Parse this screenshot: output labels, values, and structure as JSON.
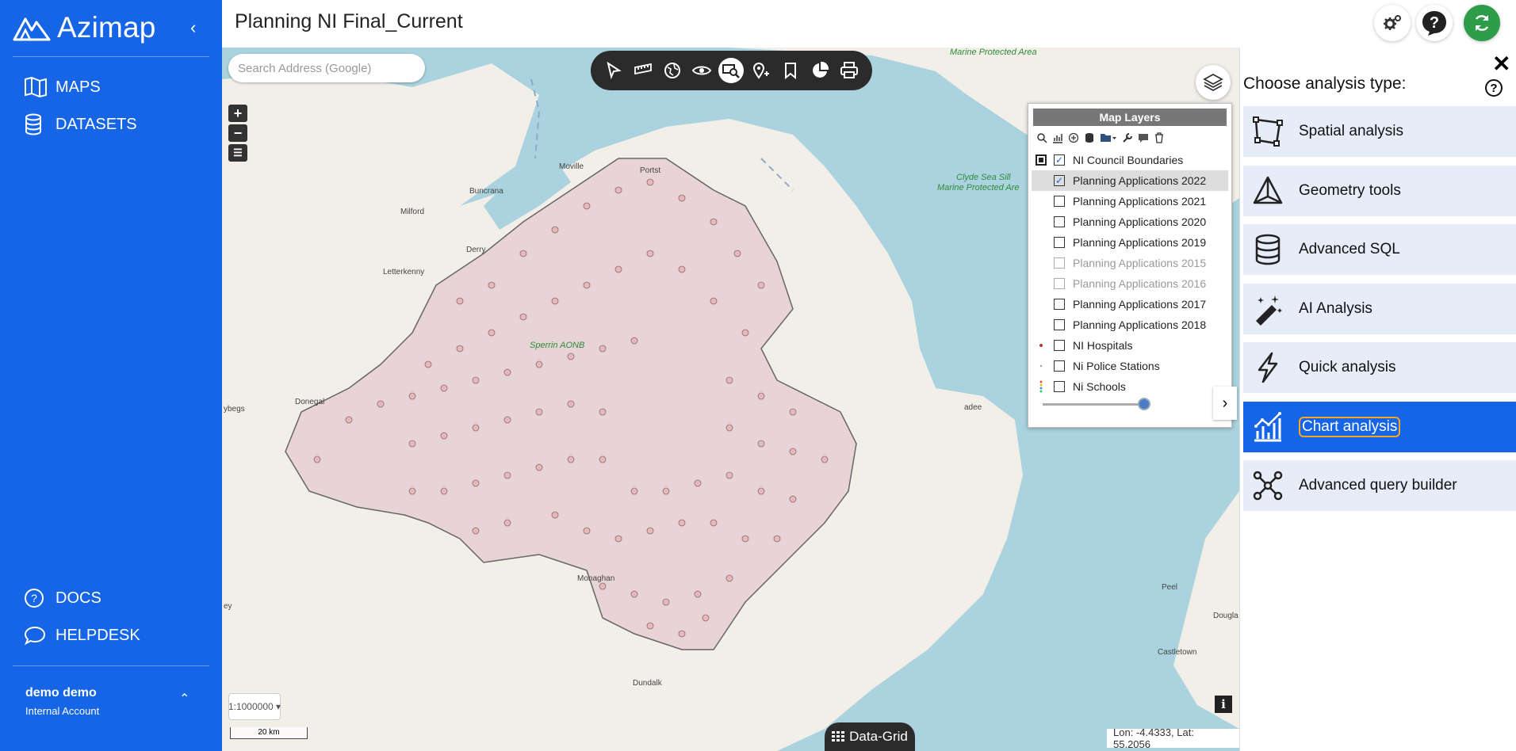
{
  "app": {
    "name": "Azimap",
    "collapse_icon": "chevron-left-icon"
  },
  "sidebar": {
    "nav": [
      {
        "label": "MAPS",
        "icon": "map-book-icon"
      },
      {
        "label": "DATASETS",
        "icon": "database-icon"
      }
    ],
    "bottom_nav": [
      {
        "label": "DOCS",
        "icon": "question-circle-icon"
      },
      {
        "label": "HELPDESK",
        "icon": "chat-bubble-icon"
      }
    ],
    "user": {
      "name": "demo demo",
      "account": "Internal Account"
    }
  },
  "header": {
    "title": "Planning NI Final_Current",
    "buttons": [
      "settings-gears-icon",
      "help-icon",
      "refresh-icon"
    ]
  },
  "map": {
    "search_placeholder": "Search Address (Google)",
    "scale_select": "1:1000000",
    "scale_bar": "20 km",
    "data_grid_label": "Data-Grid",
    "coordinates": "Lon: -4.4333, Lat: 55.2056",
    "info_label": "i",
    "labels": {
      "moville": "Moville",
      "buncrana": "Buncrana",
      "milford": "Milford",
      "derry": "Derry",
      "letterkenny": "Letterkenny",
      "donegal": "Donegal",
      "monaghan": "Monaghan",
      "dundalk": "Dundalk",
      "portstewart": "Portst",
      "peel": "Peel",
      "douglas": "Dougla",
      "castletown": "Castletown",
      "newry_coast": "adee",
      "sperrin": "Sperrin AONB",
      "mpa_top": "Marine Protected Area",
      "clyde_1": "Clyde Sea Sill",
      "clyde_2": "Marine Protected Are",
      "west_edge_1": "ybegs",
      "west_edge_2": "ey"
    },
    "toolbar": [
      {
        "name": "select-pointer-icon",
        "active": false
      },
      {
        "name": "measure-ruler-icon",
        "active": false
      },
      {
        "name": "globe-icon",
        "active": false
      },
      {
        "name": "visibility-eye-icon",
        "active": false
      },
      {
        "name": "search-query-icon",
        "active": true
      },
      {
        "name": "location-pin-icon",
        "active": false
      },
      {
        "name": "bookmark-icon",
        "active": false
      },
      {
        "name": "pie-chart-icon",
        "active": false
      },
      {
        "name": "print-icon",
        "active": false
      }
    ]
  },
  "layers_panel": {
    "title": "Map Layers",
    "layers": [
      {
        "label": "NI Council Boundaries",
        "checked": true,
        "dim": false,
        "selected": false,
        "legend": "boundary"
      },
      {
        "label": "Planning Applications 2022",
        "checked": true,
        "dim": false,
        "selected": true,
        "legend": "none"
      },
      {
        "label": "Planning Applications 2021",
        "checked": false,
        "dim": false,
        "selected": false,
        "legend": "none"
      },
      {
        "label": "Planning Applications 2020",
        "checked": false,
        "dim": false,
        "selected": false,
        "legend": "none"
      },
      {
        "label": "Planning Applications 2019",
        "checked": false,
        "dim": false,
        "selected": false,
        "legend": "none"
      },
      {
        "label": "Planning Applications 2015",
        "checked": false,
        "dim": true,
        "selected": false,
        "legend": "none"
      },
      {
        "label": "Planning Applications 2016",
        "checked": false,
        "dim": true,
        "selected": false,
        "legend": "none"
      },
      {
        "label": "Planning Applications 2017",
        "checked": false,
        "dim": false,
        "selected": false,
        "legend": "none"
      },
      {
        "label": "Planning Applications 2018",
        "checked": false,
        "dim": false,
        "selected": false,
        "legend": "none"
      },
      {
        "label": "NI Hospitals",
        "checked": false,
        "dim": false,
        "selected": false,
        "legend": "red-dot"
      },
      {
        "label": "Ni Police Stations",
        "checked": false,
        "dim": false,
        "selected": false,
        "legend": "small-dot"
      },
      {
        "label": "Ni Schools",
        "checked": false,
        "dim": false,
        "selected": false,
        "legend": "multi-dot"
      }
    ],
    "opacity": 1.0
  },
  "analysis_panel": {
    "title": "Choose analysis type:",
    "options": [
      {
        "label": "Spatial analysis",
        "icon": "spatial-polygon-icon",
        "active": false
      },
      {
        "label": "Geometry tools",
        "icon": "geometry-triangle-icon",
        "active": false
      },
      {
        "label": "Advanced SQL",
        "icon": "database-sql-icon",
        "active": false
      },
      {
        "label": "AI Analysis",
        "icon": "magic-wand-icon",
        "active": false
      },
      {
        "label": "Quick analysis",
        "icon": "lightning-icon",
        "active": false
      },
      {
        "label": "Chart analysis",
        "icon": "chart-icon",
        "active": true
      },
      {
        "label": "Advanced query builder",
        "icon": "query-network-icon",
        "active": false
      }
    ]
  },
  "colors": {
    "brand": "#1565e6",
    "sea": "#abd3df",
    "land": "#f2efe9",
    "point_fill": "#e6b8bc",
    "point_stroke": "#8a6a6e",
    "focus_outline": "#f5a623"
  }
}
